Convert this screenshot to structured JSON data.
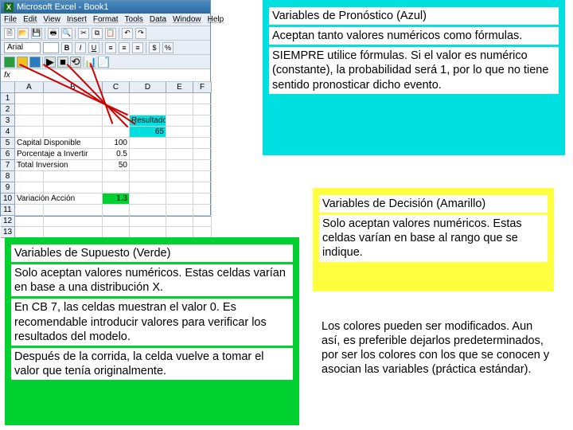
{
  "excel": {
    "title": "Microsoft Excel - Book1",
    "menu": [
      "File",
      "Edit",
      "View",
      "Insert",
      "Format",
      "Tools",
      "Data",
      "Window",
      "Help"
    ],
    "font_name": "Arial",
    "font_size": "",
    "cols": [
      "",
      "A",
      "B",
      "C",
      "D",
      "E",
      "F"
    ],
    "rows": [
      [
        "1",
        "",
        "",
        "",
        "",
        "",
        ""
      ],
      [
        "2",
        "",
        "",
        "",
        "",
        "",
        ""
      ],
      [
        "3",
        "",
        "",
        "",
        "Resultado",
        "",
        ""
      ],
      [
        "4",
        "",
        "",
        "",
        "65",
        "",
        ""
      ],
      [
        "5",
        "Capital Disponible",
        "",
        "100",
        "",
        "",
        ""
      ],
      [
        "6",
        "Porcentaje a Invertir",
        "",
        "0.5",
        "",
        "",
        ""
      ],
      [
        "7",
        "Total Inversion",
        "",
        "50",
        "",
        "",
        ""
      ],
      [
        "8",
        "",
        "",
        "",
        "",
        "",
        ""
      ],
      [
        "9",
        "",
        "",
        "",
        "",
        "",
        ""
      ],
      [
        "10",
        "Variación Acción",
        "",
        "1.3",
        "",
        "",
        ""
      ],
      [
        "11",
        "",
        "",
        "",
        "",
        "",
        ""
      ],
      [
        "12",
        "",
        "",
        "",
        "",
        "",
        ""
      ],
      [
        "13",
        "",
        "",
        "",
        "",
        "",
        ""
      ]
    ]
  },
  "blue": {
    "title": "Variables de Pronóstico (Azul)",
    "p1": "Aceptan tanto valores numéricos como fórmulas.",
    "p2": "SIEMPRE utilice fórmulas. Si el valor es numérico (constante), la probabilidad será 1, por lo que no tiene sentido pronosticar dicho evento."
  },
  "green": {
    "title": "Variables de Supuesto (Verde)",
    "p1": "Solo aceptan valores numéricos. Estas celdas varían en base a una distribución X.",
    "p2": "En CB 7, las celdas muestran el valor 0. Es recomendable introducir valores para verificar los resultados del modelo.",
    "p3": "Después de la corrida, la celda vuelve a tomar el valor que tenía originalmente."
  },
  "yellow": {
    "title": "Variables de Decisión (Amarillo)",
    "p1": "Solo aceptan valores numéricos. Estas celdas varían en base al rango que se indique."
  },
  "note": "Los colores pueden ser modificados. Aun así, es preferible dejarlos predeterminados, por ser los colores con los que se conocen y asocian las variables (práctica estándar)."
}
